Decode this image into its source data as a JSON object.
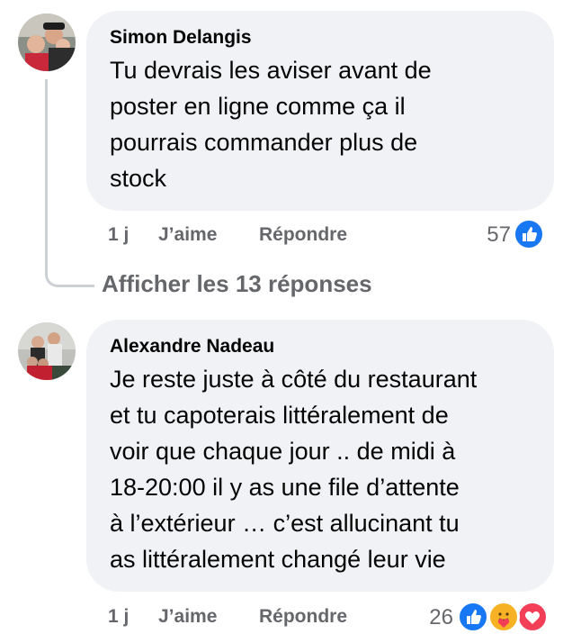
{
  "comments": [
    {
      "author": "Simon Delangis",
      "lines": [
        "Tu devrais les aviser avant de",
        "poster en ligne comme ça il",
        "pourrais commander plus de",
        "stock"
      ],
      "time": "1 j",
      "like_label": "J’aime",
      "reply_label": "Répondre",
      "reaction_count": "57",
      "reactions": [
        "like-icon"
      ]
    },
    {
      "author": "Alexandre Nadeau",
      "lines": [
        "Je reste juste à côté du restaurant",
        "et tu capoterais littéralement de",
        "voir que chaque jour .. de midi à",
        "18-20:00 il y as une file d’attente",
        "à l’extérieur … c’est allucinant tu",
        "as littéralement changé leur vie"
      ],
      "time": "1 j",
      "like_label": "J’aime",
      "reply_label": "Répondre",
      "reaction_count": "26",
      "reactions": [
        "like-icon",
        "care-icon",
        "love-icon"
      ]
    }
  ],
  "view_replies_label": "Afficher les 13 réponses",
  "colors": {
    "like_blue": "#1877f2",
    "love_red": "#f33e58",
    "care_yellow": "#f7b125",
    "muted": "#65676b",
    "bubble": "#f0f2f5"
  }
}
